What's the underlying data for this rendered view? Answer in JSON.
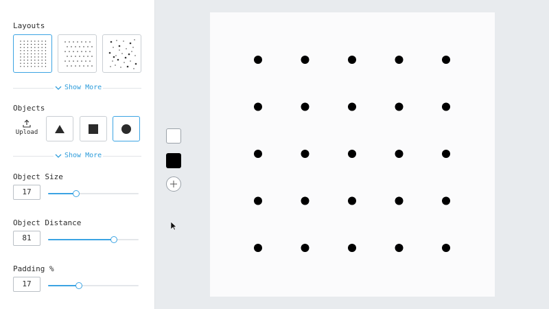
{
  "sidebar": {
    "layouts": {
      "title": "Layouts",
      "options": [
        {
          "name": "grid",
          "selected": true
        },
        {
          "name": "staggered-grid",
          "selected": false
        },
        {
          "name": "random-scatter",
          "selected": false
        }
      ],
      "show_more_label": "Show More"
    },
    "objects": {
      "title": "Objects",
      "upload_label": "Upload",
      "options": [
        {
          "name": "triangle-icon",
          "selected": false
        },
        {
          "name": "square-icon",
          "selected": false
        },
        {
          "name": "circle-icon",
          "selected": true
        }
      ],
      "show_more_label": "Show More"
    },
    "object_size": {
      "label": "Object Size",
      "value": "17",
      "slider_fraction": 0.31
    },
    "object_distance": {
      "label": "Object Distance",
      "value": "81",
      "slider_fraction": 0.73
    },
    "padding": {
      "label": "Padding %",
      "value": "17",
      "slider_fraction": 0.34
    }
  },
  "colors": {
    "accent": "#3aa3e3",
    "swatches": [
      "#ffffff",
      "#000000"
    ],
    "add_icon": "plus-icon"
  },
  "canvas": {
    "background": "#fbfbfc",
    "dot_color": "#000000",
    "rows": 5,
    "cols": 5
  }
}
